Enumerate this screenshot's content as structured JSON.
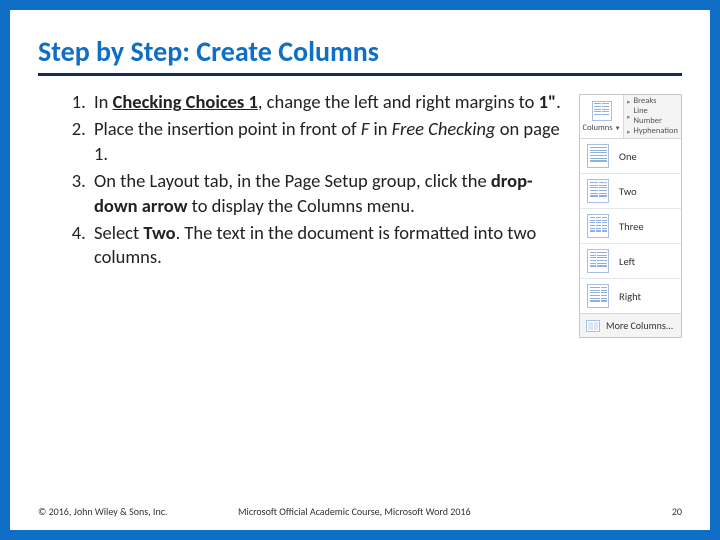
{
  "title": "Step by Step: Create Columns",
  "steps": [
    {
      "segments": [
        {
          "t": "In "
        },
        {
          "t": "Checking Choices 1",
          "cls": "bu"
        },
        {
          "t": ", change the left and right margins to "
        },
        {
          "t": "1\"",
          "cls": "b"
        },
        {
          "t": "."
        }
      ]
    },
    {
      "segments": [
        {
          "t": "Place the insertion point in front of "
        },
        {
          "t": "F",
          "cls": "i"
        },
        {
          "t": " in "
        },
        {
          "t": "Free Checking",
          "cls": "i"
        },
        {
          "t": " on page 1."
        }
      ]
    },
    {
      "segments": [
        {
          "t": "On the Layout tab, in the Page Setup group, click the "
        },
        {
          "t": "drop-down arrow",
          "cls": "b"
        },
        {
          "t": " to display the Columns menu."
        }
      ]
    },
    {
      "segments": [
        {
          "t": "Select "
        },
        {
          "t": "Two",
          "cls": "b"
        },
        {
          "t": ". The text in the document is formatted into two columns."
        }
      ]
    }
  ],
  "menu": {
    "topLabel": "Columns",
    "topRight": [
      "Breaks",
      "Line Number",
      "Hyphenation"
    ],
    "items": [
      {
        "label": "One",
        "cols": 1
      },
      {
        "label": "Two",
        "cols": 2
      },
      {
        "label": "Three",
        "cols": 3
      },
      {
        "label": "Left",
        "cols": 2,
        "leftNarrow": true
      },
      {
        "label": "Right",
        "cols": 2,
        "rightNarrow": true
      }
    ],
    "more": "More Columns..."
  },
  "footer": {
    "copyright": "© 2016, John Wiley & Sons, Inc.",
    "course": "Microsoft Official Academic Course, Microsoft Word 2016",
    "page": "20"
  }
}
